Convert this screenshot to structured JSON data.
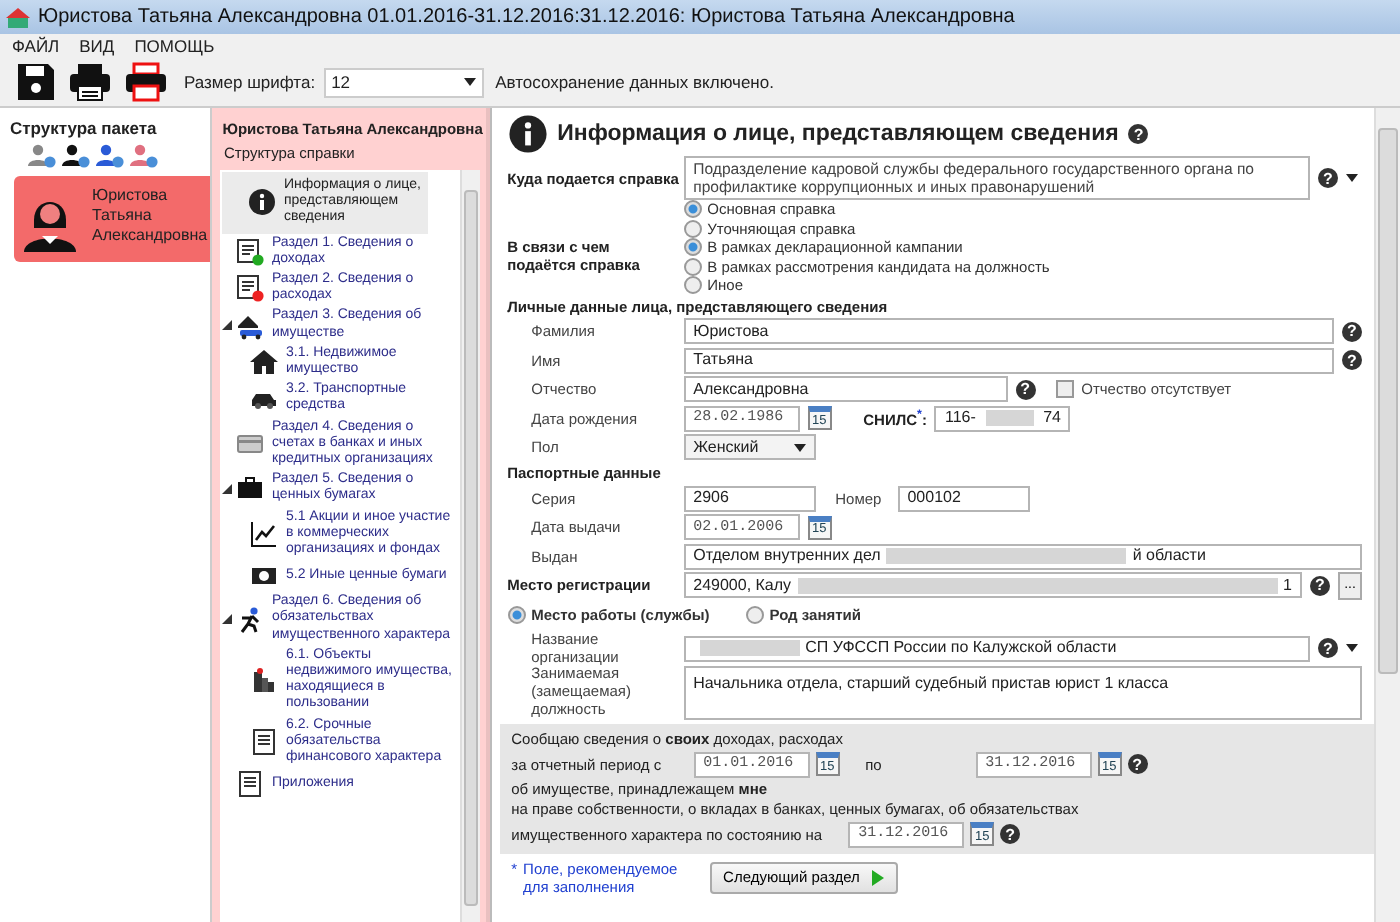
{
  "window": {
    "title": "Юристова Татьяна Александровна 01.01.2016-31.12.2016:31.12.2016: Юристова Татьяна Александровна"
  },
  "menu": [
    "ФАЙЛ",
    "ВИД",
    "ПОМОЩЬ"
  ],
  "toolbar": {
    "font_size_label": "Размер шрифта:",
    "font_size": "12",
    "autosave": "Автосохранение данных включено."
  },
  "package": {
    "title": "Структура пакета",
    "persons": [
      {
        "name": "Юристова Татьяна Александровна",
        "selected": true
      }
    ]
  },
  "tree": {
    "person": "Юристова Татьяна Александровна",
    "title": "Структура справки",
    "items": [
      {
        "label": "Информация о лице, представляющем сведения",
        "kind": "info",
        "selected": true
      },
      {
        "label": "Раздел 1. Сведения о доходах",
        "kind": "income",
        "selected": false
      },
      {
        "label": "Раздел 2. Сведения о расходах",
        "kind": "expense",
        "selected": false
      },
      {
        "label": "Раздел 3. Сведения об имуществе",
        "kind": "property",
        "selected": false,
        "expanded": true,
        "children": [
          {
            "label": "3.1. Недвижимое имущество",
            "kind": "house",
            "selected": false
          },
          {
            "label": "3.2. Транспортные средства",
            "kind": "car",
            "selected": false
          }
        ]
      },
      {
        "label": "Раздел 4. Сведения о счетах в банках и иных кредитных организациях",
        "kind": "bank",
        "selected": false
      },
      {
        "label": "Раздел 5. Сведения о ценных бумагах",
        "kind": "briefcase",
        "selected": false,
        "expanded": true,
        "children": [
          {
            "label": "5.1 Акции и иное участие в коммерческих организациях и фондах",
            "kind": "chart",
            "selected": false
          },
          {
            "label": "5.2 Иные ценные бумаги",
            "kind": "securities",
            "selected": false
          }
        ]
      },
      {
        "label": "Раздел 6. Сведения об обязательствах имущественного характера",
        "kind": "runner",
        "selected": false,
        "expanded": true,
        "children": [
          {
            "label": "6.1. Объекты недвижимого имущества, находящиеся в пользовании",
            "kind": "building",
            "selected": false
          },
          {
            "label": "6.2. Срочные обязательства финансового характера",
            "kind": "document",
            "selected": false
          }
        ]
      },
      {
        "label": "Приложения",
        "kind": "document",
        "selected": false
      }
    ]
  },
  "form": {
    "title": "Информация о лице, представляющем сведения",
    "help_glyph": "?",
    "recipient": {
      "label": "Куда подается справка",
      "value": "Подразделение кадровой службы федерального государственного органа по профилактике коррупционных и иных правонарушений"
    },
    "report_type": [
      {
        "label": "Основная справка",
        "selected": true
      },
      {
        "label": "Уточняющая справка",
        "selected": false
      }
    ],
    "reason": {
      "label": "В связи с чем подаётся справка",
      "options": [
        {
          "label": "В рамках декларационной кампании",
          "selected": true
        },
        {
          "label": "В рамках рассмотрения кандидата на должность",
          "selected": false
        },
        {
          "label": "Иное",
          "selected": false
        }
      ]
    },
    "personal": {
      "heading": "Личные данные лица, представляющего сведения",
      "surname": {
        "label": "Фамилия",
        "value": "Юристова"
      },
      "name": {
        "label": "Имя",
        "value": "Татьяна"
      },
      "patronymic": {
        "label": "Отчество",
        "value": "Александровна",
        "absent_label": "Отчество отсутствует",
        "absent": false
      },
      "birth_date": {
        "label": "Дата рождения",
        "value": "28.02.1986",
        "calendar_day": "15"
      },
      "snils": {
        "label": "СНИЛС$^{*}$:",
        "segments": [
          {
            "kind": "text",
            "text": "116-"
          },
          {
            "kind": "redacted"
          },
          {
            "kind": "text",
            "text": "74"
          }
        ]
      },
      "sex": {
        "label": "Пол",
        "value": "Женский"
      }
    },
    "passport": {
      "heading": "Паспортные данные",
      "series": {
        "label": "Серия",
        "value": "2906"
      },
      "number": {
        "label": "Номер",
        "value": "000102"
      },
      "issue_date": {
        "label": "Дата выдачи",
        "value": "02.01.2006",
        "calendar_day": "15"
      },
      "issued_by": {
        "label": "Выдан",
        "segments": [
          {
            "kind": "text",
            "text": "Отделом внутренних дел"
          },
          {
            "kind": "redacted"
          },
          {
            "kind": "text",
            "text": "й области"
          }
        ]
      }
    },
    "registration": {
      "label": "Место регистрации",
      "segments": [
        {
          "kind": "text",
          "text": "249000, Калу"
        },
        {
          "kind": "redacted"
        },
        {
          "kind": "text",
          "text": "1"
        }
      ],
      "button": "..."
    },
    "work_type": [
      {
        "label": "Место работы (службы)",
        "selected": true
      },
      {
        "label": "Род занятий",
        "selected": false
      }
    ],
    "organization": {
      "label": "Название организации",
      "segments": [
        {
          "kind": "redacted"
        },
        {
          "kind": "text",
          "text": "СП УФССП России по Калужской области"
        }
      ]
    },
    "position": {
      "label": "Занимаемая (замещаемая) должность",
      "value": "Начальника отдела, старший судебный пристав юрист 1 класса"
    },
    "period": {
      "line1": "Сообщаю сведения о **своих** доходах, расходах",
      "from_label": "за отчетный период с",
      "from": {
        "value": "01.01.2016",
        "calendar_day": "15"
      },
      "to_label": "по",
      "to": {
        "value": "31.12.2016",
        "calendar_day": "15"
      },
      "line2": "об имуществе, принадлежащем **мне**",
      "line3": "на праве собственности, о вкладах в банках, ценных бумагах, об обязательствах",
      "line4": "имущественного характера по состоянию на",
      "as_of": {
        "value": "31.12.2016",
        "calendar_day": "15"
      }
    },
    "footnote": {
      "mark": "*",
      "text": "Поле, рекомендуемое для заполнения"
    },
    "next_button": "Следующий раздел"
  }
}
